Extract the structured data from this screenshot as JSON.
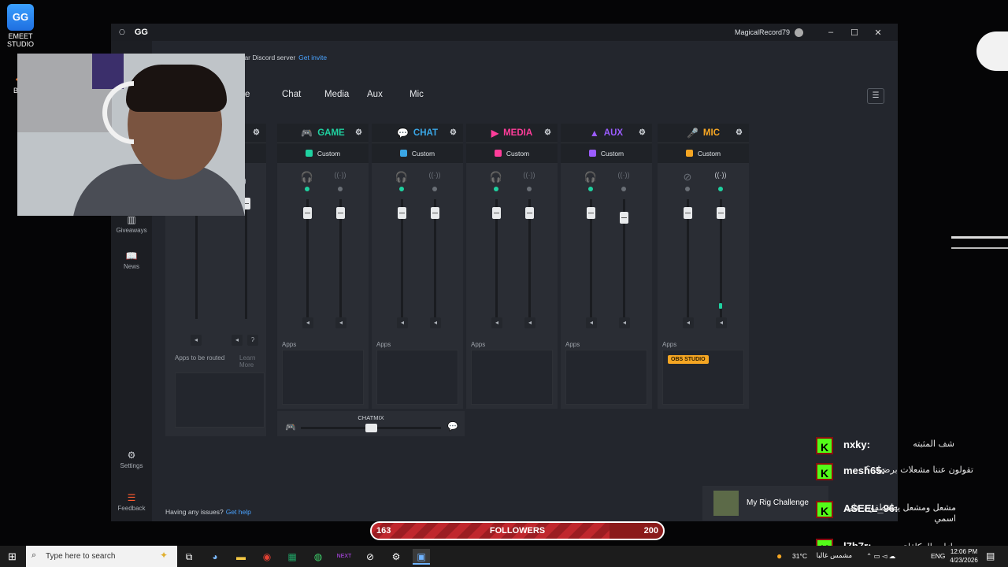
{
  "desktop": {
    "icons": [
      {
        "label_lines": [
          "EMEET",
          "STUDIO"
        ],
        "glyph": "GG"
      },
      {
        "label": "Blen",
        "glyph": "◆"
      }
    ]
  },
  "window": {
    "title": "GG",
    "user": "MagicalRecord79",
    "controls": [
      "–",
      "☐",
      "✕"
    ]
  },
  "banner": {
    "text": "onar Discord server",
    "link": "Get invite"
  },
  "tabs": [
    "e",
    "Chat",
    "Media",
    "Aux",
    "Mic"
  ],
  "menu_icon": "hamburger-icon",
  "sidebar": [
    {
      "label": "Giveaways",
      "icon": "gift-icon",
      "glyph": "▥"
    },
    {
      "label": "News",
      "icon": "book-icon",
      "glyph": "📖"
    },
    {
      "label": "Settings",
      "icon": "gear-icon",
      "glyph": "⚙"
    },
    {
      "label": "Feedback",
      "icon": "feedback-icon",
      "glyph": "☰"
    }
  ],
  "channels": [
    {
      "name": "GAME",
      "color": "#1fd1a0",
      "preset": "Custom",
      "glyph": "🎮",
      "left_icon": "headphones-icon",
      "right_icon": "stream-icon",
      "left_on": true,
      "right_on": false,
      "left_level": 0.92,
      "right_level": 0.92
    },
    {
      "name": "CHAT",
      "color": "#3aa7e6",
      "preset": "Custom",
      "glyph": "💬",
      "left_icon": "headphones-icon",
      "right_icon": "stream-icon",
      "left_on": true,
      "right_on": false,
      "left_level": 0.92,
      "right_level": 0.92
    },
    {
      "name": "MEDIA",
      "color": "#ff3d9a",
      "preset": "Custom",
      "glyph": "▶",
      "left_icon": "headphones-icon",
      "right_icon": "stream-icon",
      "left_on": true,
      "right_on": false,
      "left_level": 0.92,
      "right_level": 0.92
    },
    {
      "name": "AUX",
      "color": "#9b5cff",
      "preset": "Custom",
      "glyph": "▲",
      "left_icon": "headphones-icon",
      "right_icon": "stream-icon",
      "left_on": true,
      "right_on": false,
      "left_level": 0.92,
      "right_level": 0.88
    },
    {
      "name": "MIC",
      "color": "#f5a623",
      "preset": "Custom",
      "glyph": "🎤",
      "left_icon": "headphones-off-icon",
      "right_icon": "stream-icon",
      "left_on": false,
      "right_on": true,
      "left_level": 0.92,
      "right_level": 0.92
    }
  ],
  "apps_label": "Apps",
  "first_column": {
    "apps_text": "Apps to be routed",
    "learn_more": "Learn More"
  },
  "mic_apps": [
    "OBS STUDIO"
  ],
  "chatmix": {
    "label": "CHATMIX",
    "position": 0.5
  },
  "help": {
    "text": "Having any issues?",
    "link": "Get help"
  },
  "chat_overlay": [
    {
      "user": "nxky:",
      "message": "شف المثبته"
    },
    {
      "user": "mesh65:",
      "message": "تقولون عننا مشعلات برضيك ؟"
    },
    {
      "user": "ASEEL_96:",
      "message": "مشعل ومشعل يطقطقون على اسمي"
    },
    {
      "user": "l7b7r:",
      "message": "مازلت المكافاة"
    }
  ],
  "notification": {
    "text": "My Rig Challenge"
  },
  "followers": {
    "current": "163",
    "label": "FOLLOWERS",
    "goal": "200",
    "progress": 0.815
  },
  "taskbar": {
    "search_placeholder": "Type here to search",
    "apps": [
      "task-view-icon",
      "copilot-icon",
      "file-explorer-icon",
      "chrome-icon",
      "excel-icon",
      "xbox-icon",
      "next-icon",
      "steelseries-icon",
      "gg-icon",
      "emeet-icon"
    ],
    "weather": "31°C",
    "weather_text": "مشمس غالبا",
    "lang": "ENG",
    "time": "12:06 PM",
    "date": "4/23/2026"
  },
  "colors": {
    "accent_green": "#1fd1a0",
    "link": "#4aa3ff",
    "window_bg": "#23262d"
  }
}
